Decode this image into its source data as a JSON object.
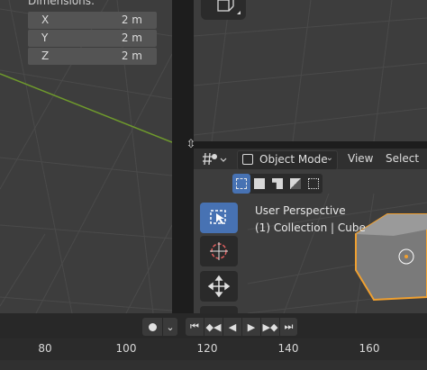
{
  "properties_panel": {
    "dimensions_label": "Dimensions:",
    "fields": [
      {
        "axis": "X",
        "value": "2 m"
      },
      {
        "axis": "Y",
        "value": "2 m"
      },
      {
        "axis": "Z",
        "value": "2 m"
      }
    ]
  },
  "viewport_header": {
    "mode_label": "Object Mode",
    "menus": [
      "View",
      "Select"
    ]
  },
  "viewport": {
    "perspective_label": "User Perspective",
    "collection_label": "(1) Collection | Cube"
  },
  "timeline": {
    "ticks": [
      "80",
      "100",
      "120",
      "140",
      "160"
    ]
  },
  "colors": {
    "accent": "#4772b3",
    "selection_outline": "#f0a030",
    "x_axis_line": "#6f9a2c"
  }
}
